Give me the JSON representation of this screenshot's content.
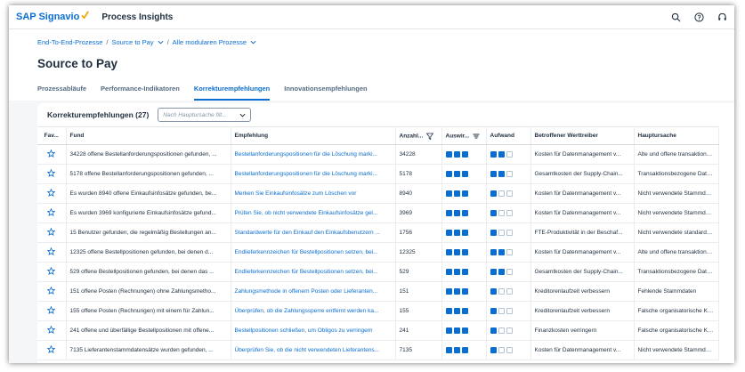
{
  "shell": {
    "brand": "SAP Signavio",
    "app": "Process Insights"
  },
  "breadcrumb": {
    "items": [
      "End-To-End-Prozesse",
      "Source to Pay",
      "Alle modularen Prozesse"
    ]
  },
  "page": {
    "title": "Source to Pay"
  },
  "tabs": [
    {
      "label": "Prozessabläufe",
      "active": false
    },
    {
      "label": "Performance-Indikatoren",
      "active": false
    },
    {
      "label": "Korrekturempfehlungen",
      "active": true
    },
    {
      "label": "Innovationsempfehlungen",
      "active": false
    }
  ],
  "card": {
    "title": "Korrekturempfehlungen (27)",
    "filter_placeholder": "Nach Hauptursache filt..."
  },
  "table": {
    "headers": [
      "Fav...",
      "Fund",
      "Empfehlung",
      "Anzahl...",
      "Auswir...",
      "Aufwand",
      "Betroffener Werttreiber",
      "Hauptursache"
    ],
    "rows": [
      {
        "fund": "34228 offene Bestellanforderungspositionen gefunden, ...",
        "empfehlung": "Bestellanforderungspositionen für die Löschung marki...",
        "anzahl": "34228",
        "auswirkung": 3,
        "aufwand": 2,
        "werttreiber": "Kosten für Datenmanagement v...",
        "ursache": "Alte und offene transaktionsb..."
      },
      {
        "fund": "5178 offene Bestellanforderungspositionen gefunden, ...",
        "empfehlung": "Bestellanforderungspositionen für die Löschung marki...",
        "anzahl": "5178",
        "auswirkung": 3,
        "aufwand": 2,
        "werttreiber": "Gesamtkosten der Supply-Chain...",
        "ursache": "Transaktionsbezogene Daten..."
      },
      {
        "fund": "Es wurden 8940 offene Einkaufsinfosätze gefunden, be...",
        "empfehlung": "Merken Sie Einkaufsinfosätze zum Löschen vor",
        "anzahl": "8940",
        "auswirkung": 3,
        "aufwand": 1,
        "werttreiber": "Kosten für Datenmanagement v...",
        "ursache": "Nicht verwendete Stammdate..."
      },
      {
        "fund": "Es wurden 3969 konfigurierte Einkaufsinfosätze gefund...",
        "empfehlung": "Prüfen Sie, ob nicht verwendete Einkaufsinfosätze gel...",
        "anzahl": "3969",
        "auswirkung": 3,
        "aufwand": 1,
        "werttreiber": "Kosten für Datenmanagement v...",
        "ursache": "Nicht verwendete Stammdate..."
      },
      {
        "fund": "15 Benutzer gefunden, die regelmäßig Bestellungen an...",
        "empfehlung": "Standardwerte für den Einkauf den Einkaufsbenutzern ...",
        "anzahl": "1756",
        "auswirkung": 3,
        "aufwand": 1,
        "werttreiber": "FTE-Produktivität in der Beschaf...",
        "ursache": "Nicht verwendete standardma..."
      },
      {
        "fund": "12325 offene Bestellpositionen gefunden, bei denen d...",
        "empfehlung": "Endlieferkennzeichen für Bestellpositionen setzen, bei...",
        "anzahl": "12325",
        "auswirkung": 3,
        "aufwand": 2,
        "werttreiber": "Kosten für Datenmanagement v...",
        "ursache": "Alte und offene transaktionsb..."
      },
      {
        "fund": "529 offene Bestellpositionen gefunden, bei denen das ...",
        "empfehlung": "Endlieferkennzeichen für Bestellpositionen setzen, bei...",
        "anzahl": "529",
        "auswirkung": 3,
        "aufwand": 2,
        "werttreiber": "Gesamtkosten der Supply-Chain...",
        "ursache": "Transaktionsbezogene Daten..."
      },
      {
        "fund": "151 offene Posten (Rechnungen) ohne Zahlungsmetho...",
        "empfehlung": "Zahlungsmethode in offenem Posten oder Lieferanten...",
        "anzahl": "151",
        "auswirkung": 3,
        "aufwand": 1,
        "werttreiber": "Kreditorenlaufzeit verbessern",
        "ursache": "Fehlende Stammdaten"
      },
      {
        "fund": "155 offene Posten (Rechnungen) mit einem für Zahlun...",
        "empfehlung": "Überprüfen, ob die Zahlungssperre entfernt werden ka...",
        "anzahl": "155",
        "auswirkung": 3,
        "aufwand": 1,
        "werttreiber": "Kreditorenlaufzeit verbessern",
        "ursache": "Falsche organisatorische Koo..."
      },
      {
        "fund": "241 offene und überfällige Bestellpositionen mit offene...",
        "empfehlung": "Bestellpositionen schließen, um Obligos zu verringern",
        "anzahl": "241",
        "auswirkung": 3,
        "aufwand": 1,
        "werttreiber": "Finanzkosten verringern",
        "ursache": "Falsche organisatorische Koo..."
      },
      {
        "fund": "7135 Lieferantenstammdatensätze wurden gefunden, ...",
        "empfehlung": "Überprüfen Sie, ob die nicht verwendeten Lieferantens...",
        "anzahl": "7135",
        "auswirkung": 3,
        "aufwand": 1,
        "werttreiber": "Kosten für Datenmanagement v...",
        "ursache": "Nicht verwendete Stammdate..."
      }
    ]
  },
  "colors": {
    "accent": "#0a6ed1",
    "brand_tick": "#f0ab00"
  },
  "icons": {
    "shell": [
      "help-search-icon",
      "question-icon",
      "headset-icon"
    ],
    "favorite": "star-icon",
    "filter": "filter-icon",
    "sort": "sort-icon"
  }
}
